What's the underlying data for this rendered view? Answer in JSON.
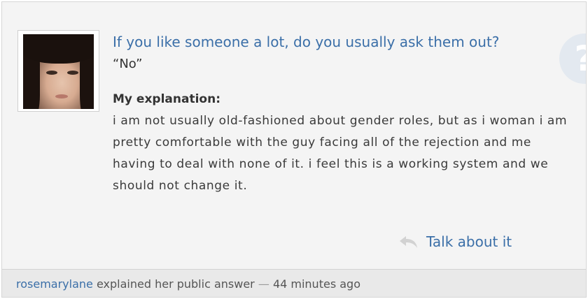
{
  "question": {
    "text": "If you like someone a lot, do you usually ask them out?",
    "answer": "“No”"
  },
  "explanation": {
    "heading": "My explanation:",
    "body": "i am not usually old-fashioned about gender roles, but as i woman i am pretty comfortable with the guy facing all of the rejection and me having to deal with none of it. i feel this is a working system and we should not change it."
  },
  "actions": {
    "talk_label": "Talk about it",
    "talk_icon": "reply-arrow-icon"
  },
  "decor": {
    "question_badge": "?"
  },
  "footer": {
    "username": "rosemarylane",
    "action_text": "explained her public answer",
    "separator": "—",
    "time_ago": "44 minutes ago"
  },
  "colors": {
    "link": "#3b6fa8",
    "card_bg": "#f4f4f4",
    "footer_bg": "#e9e9e9"
  }
}
